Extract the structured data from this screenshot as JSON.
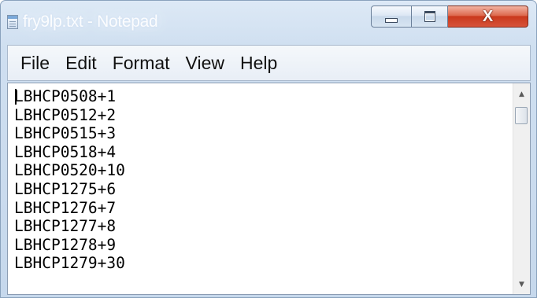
{
  "window": {
    "title": "fry9lp.txt - Notepad",
    "accent_close": "#c9391c",
    "icon": "notepad-icon"
  },
  "menubar": {
    "items": [
      "File",
      "Edit",
      "Format",
      "View",
      "Help"
    ]
  },
  "editor": {
    "lines": [
      "LBHCP0508+1",
      "LBHCP0512+2",
      "LBHCP0515+3",
      "LBHCP0518+4",
      "LBHCP0520+10",
      "LBHCP1275+6",
      "LBHCP1276+7",
      "LBHCP1277+8",
      "LBHCP1278+9",
      "LBHCP1279+30"
    ]
  },
  "controls": {
    "minimize_icon": "minimize-icon",
    "maximize_icon": "maximize-icon",
    "close_glyph": "X"
  }
}
